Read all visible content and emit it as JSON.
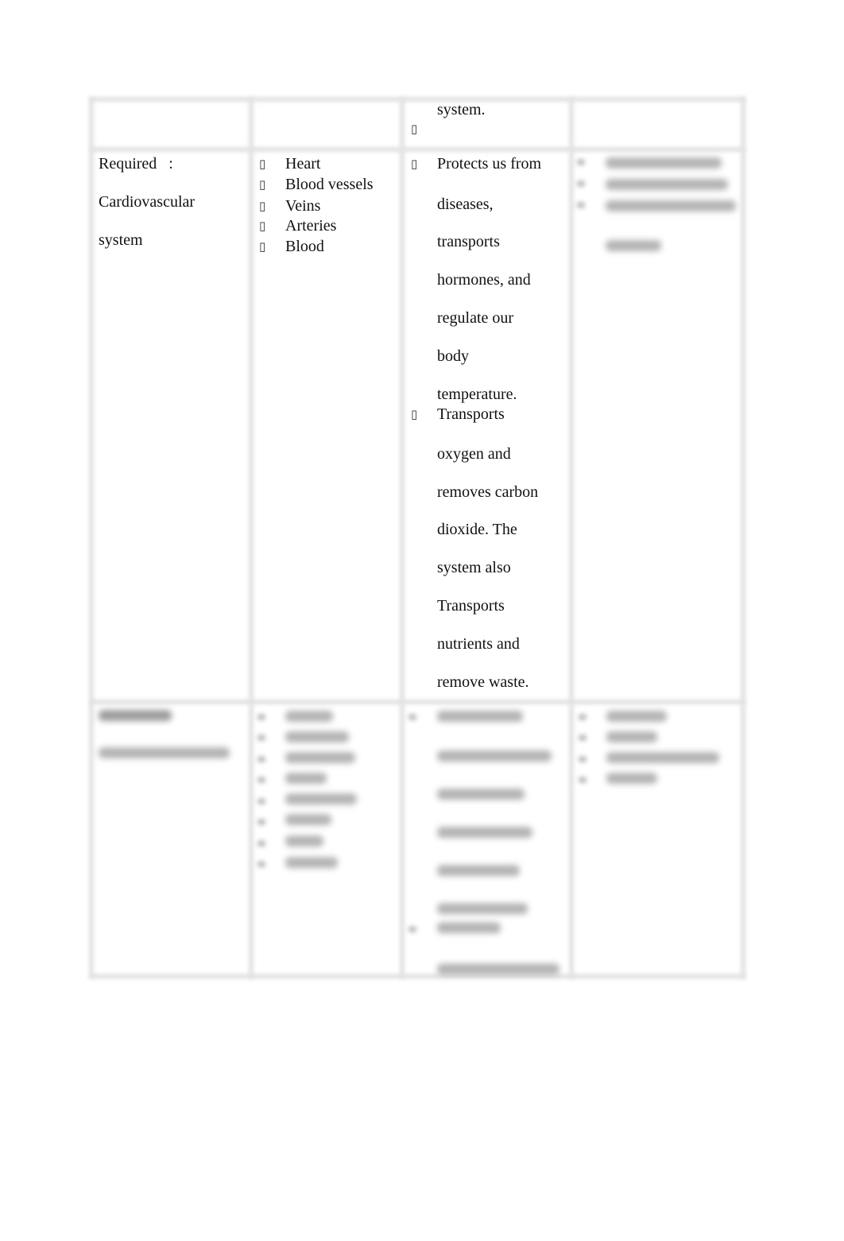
{
  "document": {
    "row_top": {
      "col3_continued_text": "system."
    },
    "row_cardiovascular": {
      "label_line1": "Required   :",
      "label_line2": "Cardiovascular",
      "label_line3": "system",
      "organs": [
        "Heart",
        "Blood vessels",
        "Veins",
        "Arteries",
        "Blood"
      ],
      "functions": [
        {
          "lines": [
            "Protects us from",
            "diseases,",
            "transports",
            "hormones, and",
            "regulate our",
            "body",
            "temperature."
          ]
        },
        {
          "lines": [
            "Transports",
            "oxygen and",
            "removes carbon",
            "dioxide. The",
            "system also",
            "Transports",
            "nutrients and",
            "remove waste."
          ]
        }
      ],
      "diseases_blurred": true
    },
    "row_endocrine": {
      "content_blurred": true
    }
  },
  "bullet_icon": "missing-glyph-box"
}
